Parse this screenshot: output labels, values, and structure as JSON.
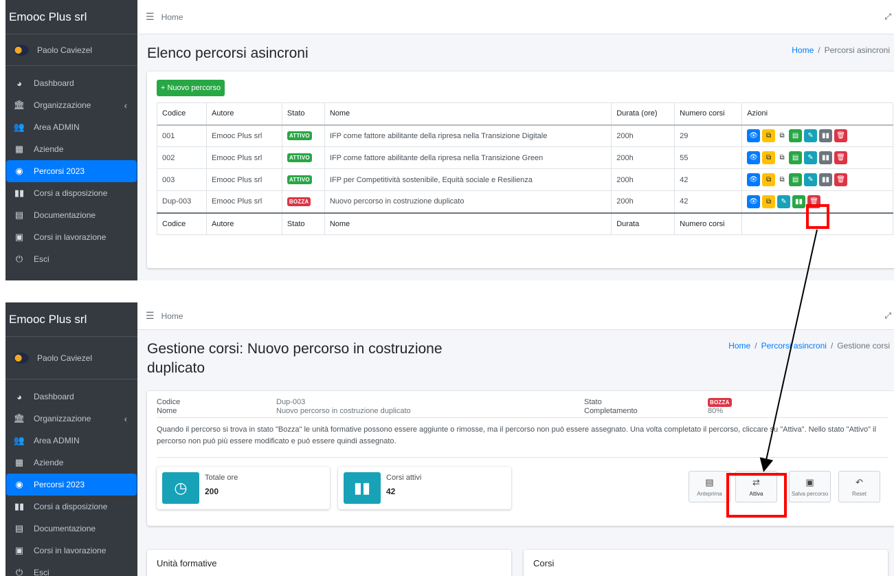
{
  "app": {
    "brand": "Emooc Plus srl",
    "user_name": "Paolo Caviezel"
  },
  "sidebar": {
    "items": [
      {
        "label": "Dashboard",
        "icon": "dashboard-icon"
      },
      {
        "label": "Organizzazione",
        "icon": "bank-icon"
      },
      {
        "label": "Area ADMIN",
        "icon": "users-icon"
      },
      {
        "label": "Aziende",
        "icon": "building-icon"
      },
      {
        "label": "Percorsi 2023",
        "icon": "binoculars-icon"
      },
      {
        "label": "Corsi a disposizione",
        "icon": "book-icon"
      },
      {
        "label": "Documentazione",
        "icon": "file-icon"
      },
      {
        "label": "Corsi in lavorazione",
        "icon": "file-excel-icon"
      },
      {
        "label": "Esci",
        "icon": "power-icon"
      }
    ]
  },
  "topbar": {
    "home": "Home"
  },
  "list_page": {
    "title": "Elenco percorsi asincroni",
    "breadcrumb": {
      "home": "Home",
      "current": "Percorsi asincroni"
    },
    "new_button": "Nuovo percorso",
    "headers": [
      "Codice",
      "Autore",
      "Stato",
      "Nome",
      "Durata (ore)",
      "Numero corsi",
      "Azioni"
    ],
    "footer": [
      "Codice",
      "Autore",
      "Stato",
      "Nome",
      "Durata",
      "Numero corsi",
      ""
    ],
    "rows": [
      {
        "code": "001",
        "author": "Emooc Plus srl",
        "status": "ATTIVO",
        "name": "IFP come fattore abilitante della ripresa nella Transizione Digitale",
        "duration": "200h",
        "courses": "29"
      },
      {
        "code": "002",
        "author": "Emooc Plus srl",
        "status": "ATTIVO",
        "name": "IFP come fattore abilitante della ripresa nella Transizione Green",
        "duration": "200h",
        "courses": "55"
      },
      {
        "code": "003",
        "author": "Emooc Plus srl",
        "status": "ATTIVO",
        "name": "IFP per Competitività sostenibile, Equità sociale e Resilienza",
        "duration": "200h",
        "courses": "42"
      },
      {
        "code": "Dup-003",
        "author": "Emooc Plus srl",
        "status": "BOZZA",
        "name": "Nuovo percorso in costruzione duplicato",
        "duration": "200h",
        "courses": "42"
      }
    ]
  },
  "detail_page": {
    "title": "Gestione corsi: Nuovo percorso in costruzione duplicato",
    "breadcrumb": {
      "home": "Home",
      "middle": "Percorsi asincroni",
      "current": "Gestione corsi"
    },
    "fields": {
      "code_label": "Codice",
      "code_value": "Dup-003",
      "name_label": "Nome",
      "name_value": "Nuovo percorso in costruzione duplicato",
      "status_label": "Stato",
      "status_value": "BOZZA",
      "completion_label": "Completamento",
      "completion_value": "80%"
    },
    "description": "Quando il percorso si trova in stato \"Bozza\" le unità formative possono essere aggiunte o rimosse, ma il percorso non può essere assegnato. Una volta completato il percorso, cliccare su \"Attiva\". Nello stato \"Attivo\" il percorso non può più essere modificato e può essere quindi assegnato.",
    "boxes": [
      {
        "label": "Totale ore",
        "value": "200"
      },
      {
        "label": "Corsi attivi",
        "value": "42"
      }
    ],
    "tools": [
      "Anteprima",
      "Attiva",
      "Salva percorso",
      "Reset"
    ],
    "sections": [
      "Unità formative",
      "Corsi"
    ]
  },
  "colors": {
    "sidebar": "#343a40",
    "active": "#007bff",
    "success": "#28a745",
    "danger": "#dc3545",
    "highlight": "#ff0000"
  }
}
